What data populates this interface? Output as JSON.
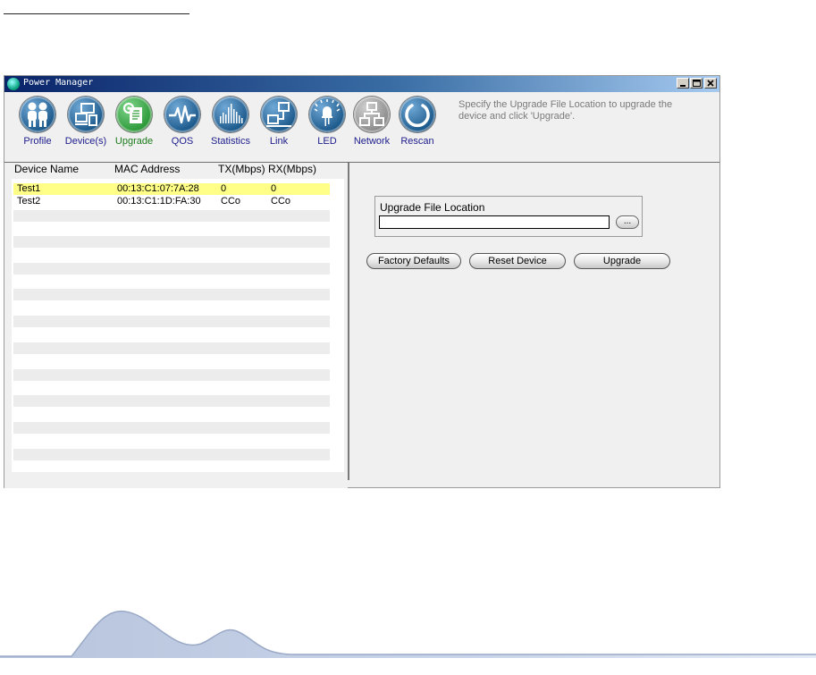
{
  "window": {
    "title": "Power Manager"
  },
  "toolbar": {
    "items": [
      {
        "label": "Profile",
        "icon": "profile-icon"
      },
      {
        "label": "Device(s)",
        "icon": "devices-icon"
      },
      {
        "label": "Upgrade",
        "icon": "upgrade-icon"
      },
      {
        "label": "QOS",
        "icon": "qos-icon"
      },
      {
        "label": "Statistics",
        "icon": "statistics-icon"
      },
      {
        "label": "Link",
        "icon": "link-icon"
      },
      {
        "label": "LED",
        "icon": "led-icon"
      },
      {
        "label": "Network",
        "icon": "network-icon"
      },
      {
        "label": "Rescan",
        "icon": "rescan-icon"
      }
    ],
    "active": "Upgrade",
    "hint": "Specify the Upgrade File Location to upgrade the device and click 'Upgrade'."
  },
  "device_list": {
    "columns": [
      "Device Name",
      "MAC Address",
      "TX(Mbps)",
      "RX(Mbps)"
    ],
    "rows": [
      {
        "name": "Test1",
        "mac": "00:13:C1:07:7A:28",
        "tx": "0",
        "rx": "0",
        "selected": true
      },
      {
        "name": "Test2",
        "mac": "00:13:C1:1D:FA:30",
        "tx": "CCo",
        "rx": "CCo",
        "selected": false
      }
    ]
  },
  "upgrade_panel": {
    "group_label": "Upgrade File Location",
    "file_value": "",
    "browse_label": "...",
    "buttons": {
      "factory_defaults": "Factory Defaults",
      "reset_device": "Reset Device",
      "upgrade": "Upgrade"
    }
  },
  "colors": {
    "title_start": "#0a246a",
    "title_end": "#a6caf0",
    "selected_row": "#ffff88",
    "label_blue": "#1c1c8c",
    "active_green": "#1a7a1a",
    "icon_blue": "#1d5a8c",
    "icon_green": "#2e9a3a",
    "icon_gray": "#8c8c8c"
  }
}
